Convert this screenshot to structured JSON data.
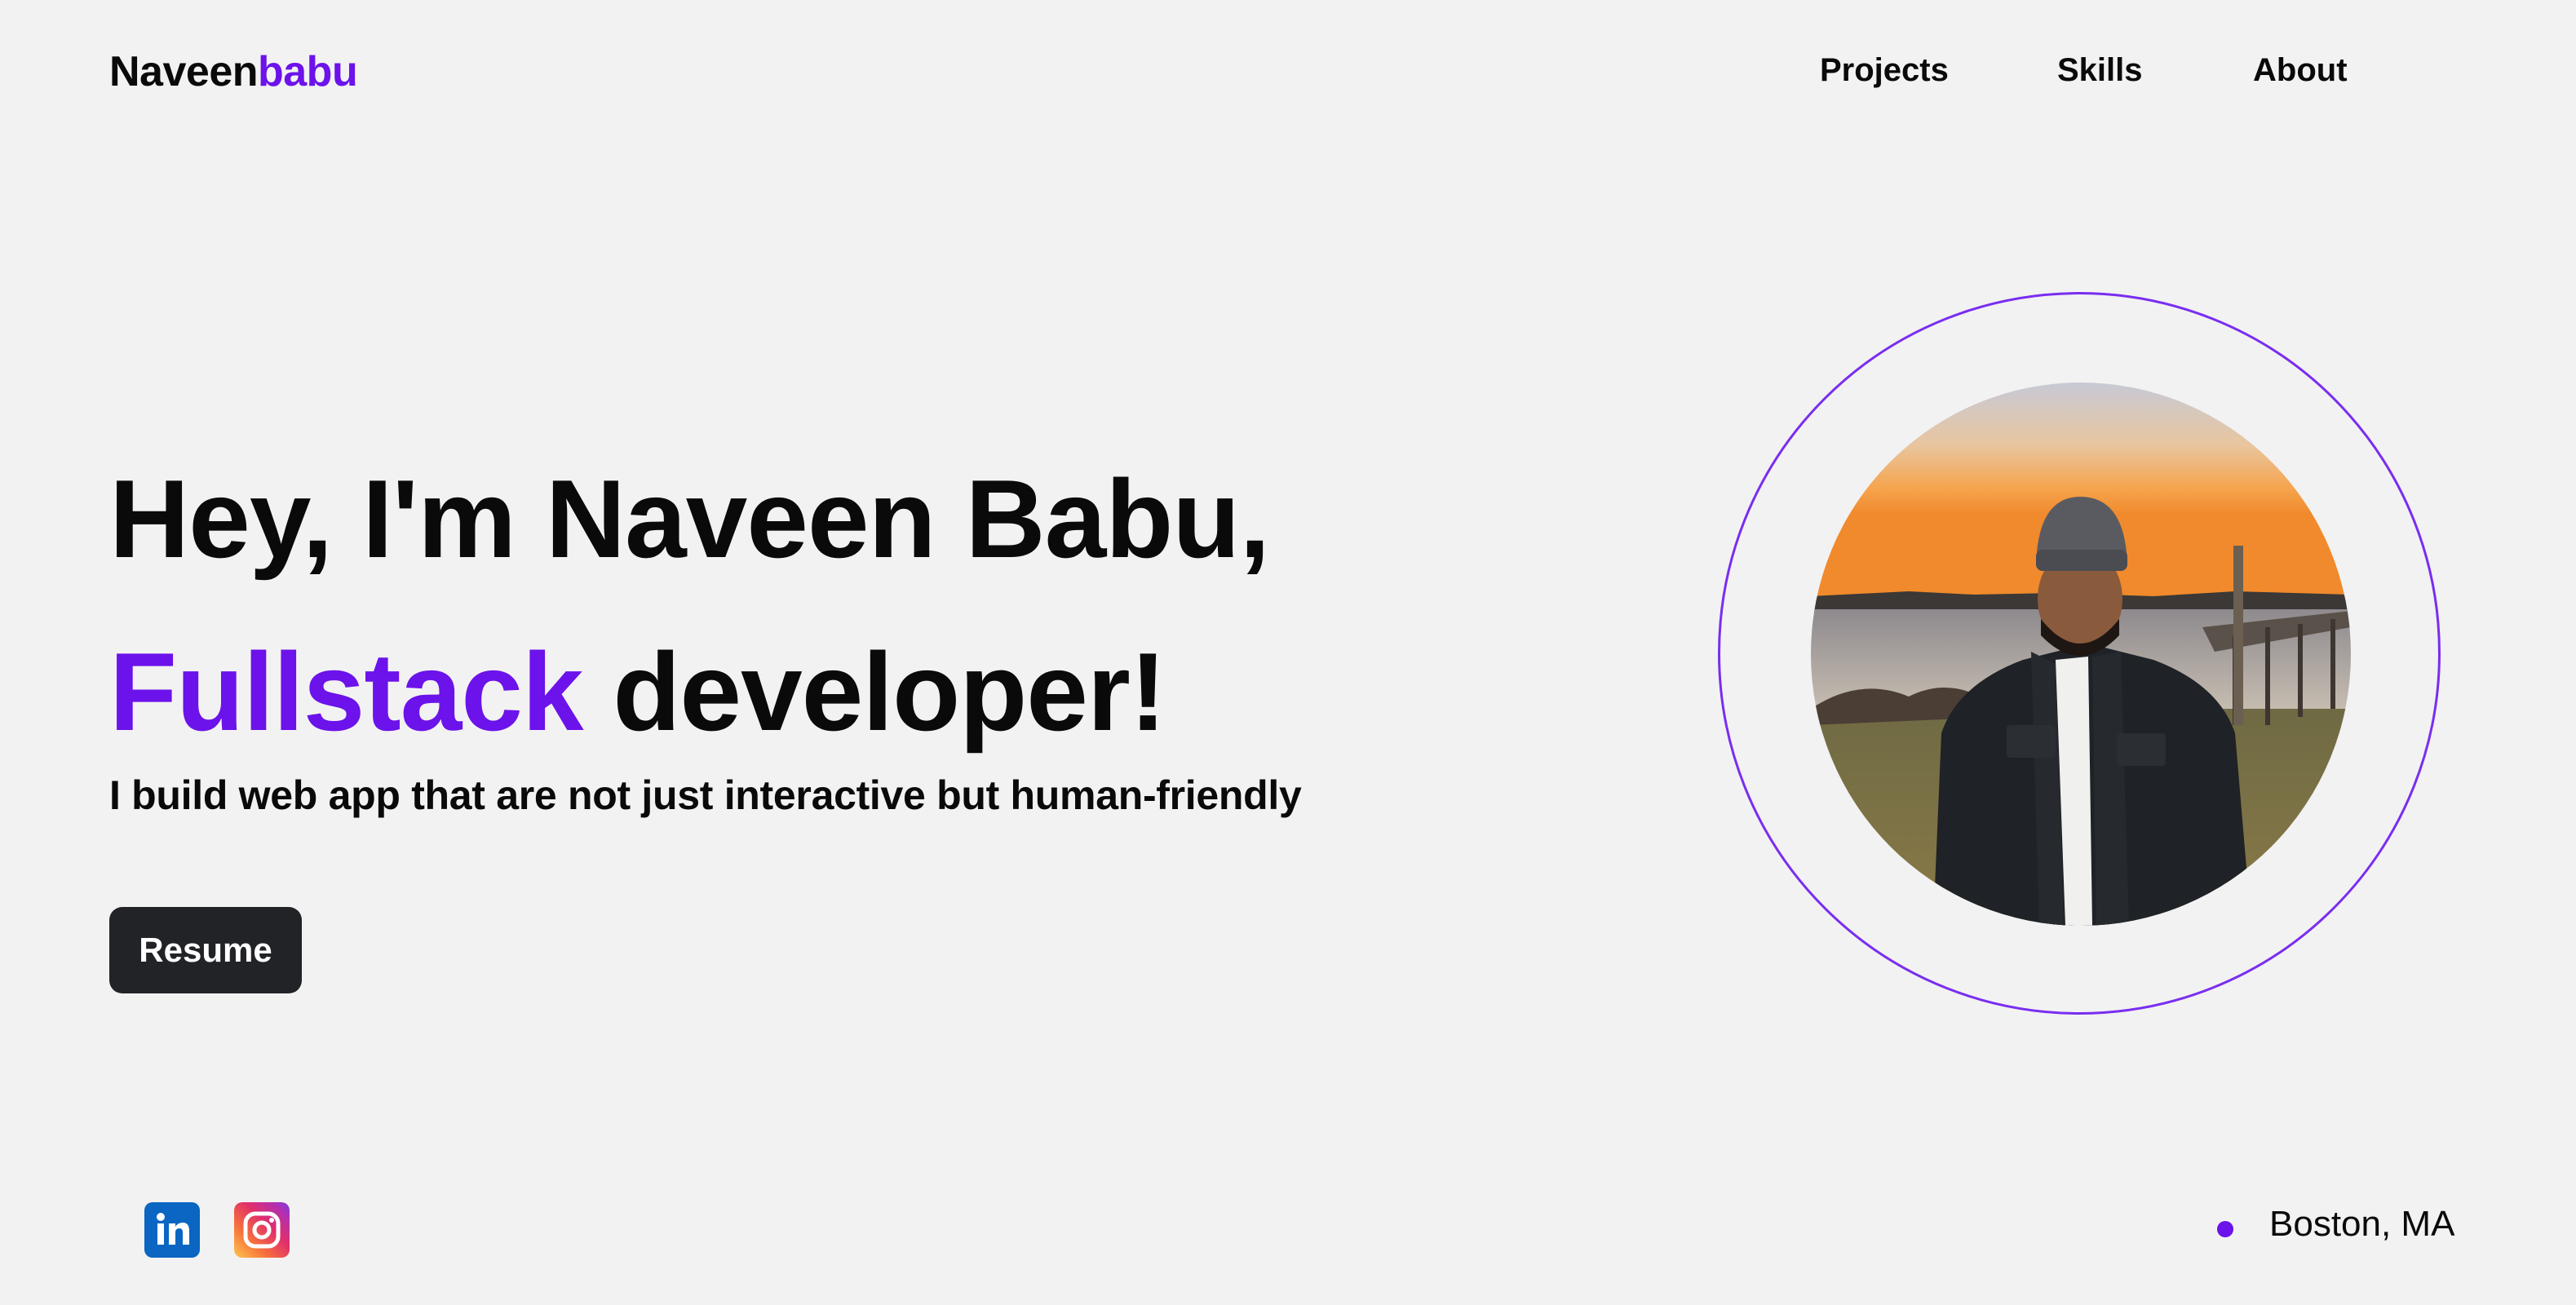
{
  "logo": {
    "first": "Naveen",
    "second": "babu"
  },
  "nav": {
    "items": [
      {
        "label": "Projects"
      },
      {
        "label": "Skills"
      },
      {
        "label": "About"
      }
    ]
  },
  "hero": {
    "line1": "Hey, I'm Naveen Babu,",
    "line2_accent": "Fullstack",
    "line2_rest": " developer!",
    "tagline": "I build web app that are not just interactive but human-friendly",
    "resume_label": "Resume",
    "photo_alt": "Naveen Babu"
  },
  "footer": {
    "social": [
      {
        "icon": "linkedin-icon"
      },
      {
        "icon": "instagram-icon"
      }
    ],
    "location": "Boston, MA"
  },
  "colors": {
    "accent": "#6c12ea",
    "background": "#f2f2f2",
    "button": "#212327"
  }
}
